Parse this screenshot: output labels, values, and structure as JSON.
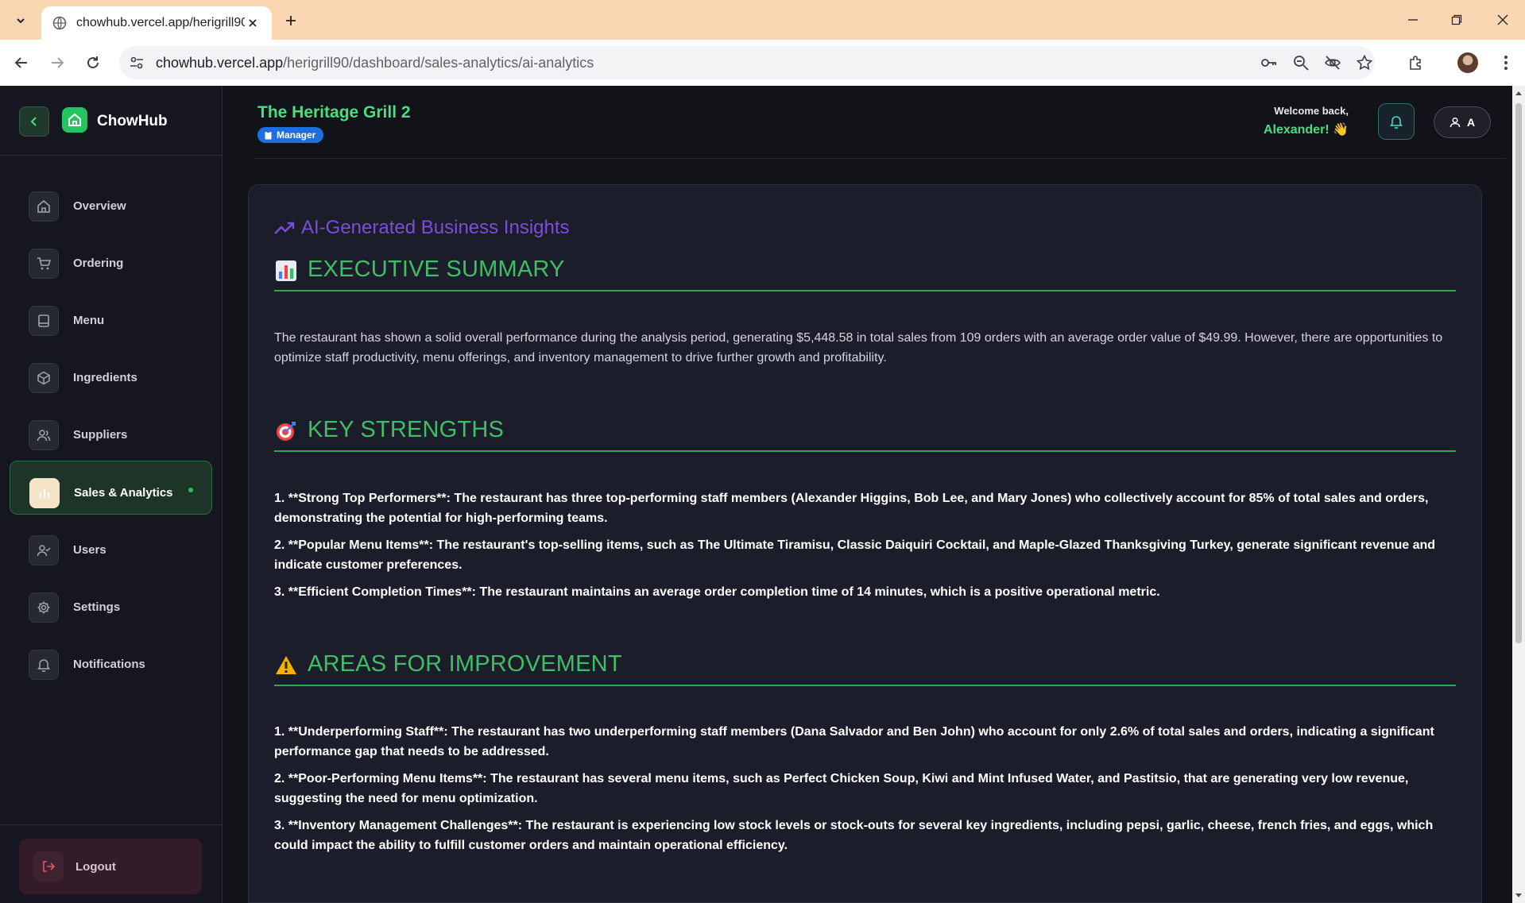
{
  "browser": {
    "tab_title": "chowhub.vercel.app/herigrill90/",
    "url_host": "chowhub.vercel.app",
    "url_path": "/herigrill90/dashboard/sales-analytics/ai-analytics"
  },
  "sidebar": {
    "brand": "ChowHub",
    "items": [
      {
        "label": "Overview",
        "icon": "home-icon"
      },
      {
        "label": "Ordering",
        "icon": "cart-icon"
      },
      {
        "label": "Menu",
        "icon": "book-icon"
      },
      {
        "label": "Ingredients",
        "icon": "box-icon"
      },
      {
        "label": "Suppliers",
        "icon": "users-icon"
      },
      {
        "label": "Sales & Analytics",
        "icon": "chart-icon",
        "active": true
      },
      {
        "label": "Users",
        "icon": "user-check-icon"
      },
      {
        "label": "Settings",
        "icon": "gear-icon"
      },
      {
        "label": "Notifications",
        "icon": "bell-icon"
      }
    ],
    "logout_label": "Logout"
  },
  "header": {
    "restaurant_name": "The Heritage Grill 2",
    "role": "Manager",
    "welcome_line": "Welcome back,",
    "user_greeting": "Alexander! 👋",
    "user_initial": "A"
  },
  "insights": {
    "title": "AI-Generated Business Insights",
    "sections": {
      "summary": {
        "emoji": "📊",
        "heading": "EXECUTIVE SUMMARY",
        "body": "The restaurant has shown a solid overall performance during the analysis period, generating $5,448.58 in total sales from 109 orders with an average order value of $49.99. However, there are opportunities to optimize staff productivity, menu offerings, and inventory management to drive further growth and profitability."
      },
      "strengths": {
        "emoji": "🎯",
        "heading": "KEY STRENGTHS",
        "items": [
          "1. **Strong Top Performers**: The restaurant has three top-performing staff members (Alexander Higgins, Bob Lee, and Mary Jones) who collectively account for 85% of total sales and orders, demonstrating the potential for high-performing teams.",
          "2. **Popular Menu Items**: The restaurant's top-selling items, such as The Ultimate Tiramisu, Classic Daiquiri Cocktail, and Maple-Glazed Thanksgiving Turkey, generate significant revenue and indicate customer preferences.",
          "3. **Efficient Completion Times**: The restaurant maintains an average order completion time of 14 minutes, which is a positive operational metric."
        ]
      },
      "improvement": {
        "emoji": "⚠️",
        "heading": "AREAS FOR IMPROVEMENT",
        "items": [
          "1. **Underperforming Staff**: The restaurant has two underperforming staff members (Dana Salvador and Ben John) who account for only 2.6% of total sales and orders, indicating a significant performance gap that needs to be addressed.",
          "2. **Poor-Performing Menu Items**: The restaurant has several menu items, such as Perfect Chicken Soup, Kiwi and Mint Infused Water, and Pastitsio, that are generating very low revenue, suggesting the need for menu optimization.",
          "3. **Inventory Management Challenges**: The restaurant is experiencing low stock levels or stock-outs for several key ingredients, including pepsi, garlic, cheese, french fries, and eggs, which could impact the ability to fulfill customer orders and maintain operational efficiency."
        ]
      }
    }
  },
  "colors": {
    "accent_green": "#22c55e",
    "heading_green": "#3fbf63",
    "title_purple": "#7c4ddb",
    "badge_blue": "#1d6fe0"
  }
}
